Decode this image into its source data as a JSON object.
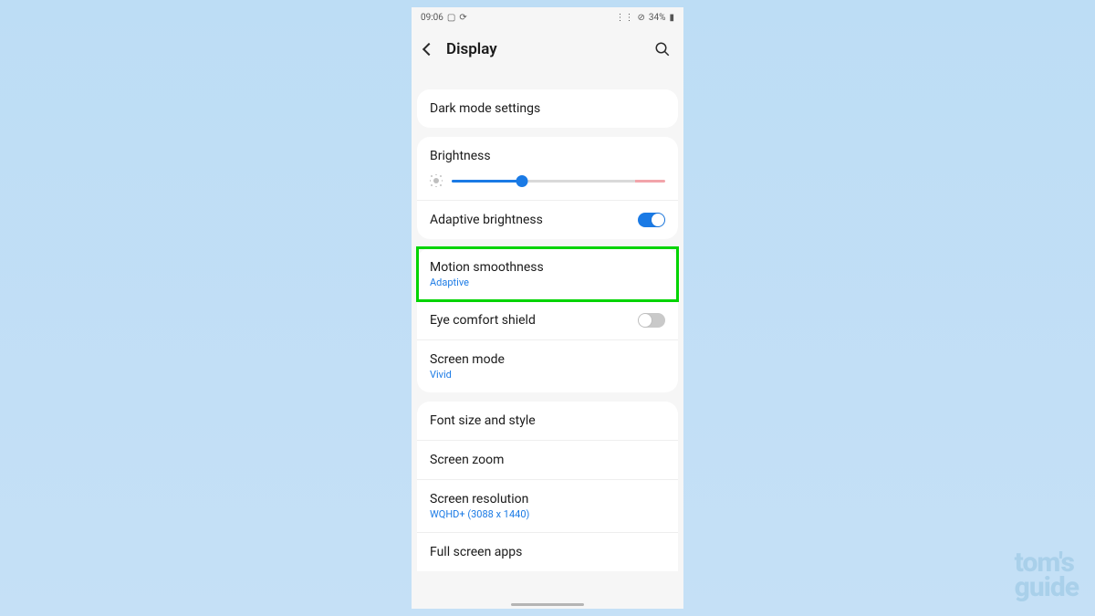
{
  "statusbar": {
    "time": "09:06",
    "battery": "34%"
  },
  "header": {
    "title": "Display"
  },
  "cards": [
    {
      "rows": [
        {
          "title": "Dark mode settings"
        }
      ]
    },
    {
      "rows": [
        {
          "title": "Brightness",
          "type": "brightness",
          "value_pct": 33
        },
        {
          "title": "Adaptive brightness",
          "type": "toggle",
          "on": true
        }
      ]
    },
    {
      "rows": [
        {
          "title": "Motion smoothness",
          "sub": "Adaptive",
          "highlighted": true
        },
        {
          "title": "Eye comfort shield",
          "type": "toggle",
          "on": false
        },
        {
          "title": "Screen mode",
          "sub": "Vivid"
        }
      ]
    },
    {
      "rows": [
        {
          "title": "Font size and style"
        },
        {
          "title": "Screen zoom"
        },
        {
          "title": "Screen resolution",
          "sub": "WQHD+ (3088 x 1440)"
        },
        {
          "title": "Full screen apps"
        }
      ]
    }
  ],
  "watermark": {
    "line1": "tom's",
    "line2": "guide"
  }
}
